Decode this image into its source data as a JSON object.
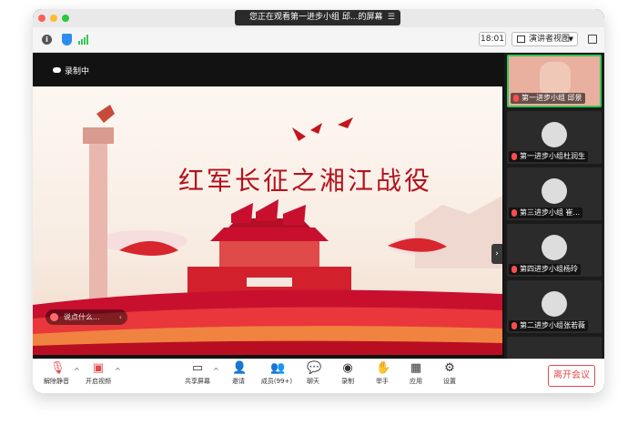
{
  "window": {
    "title": "您正在观看第一进步小组 邱...的屏幕",
    "time": "18:01",
    "view_mode": "演讲者视图"
  },
  "main": {
    "recording_label": "录制中",
    "slide_title": "红军长征之湘江战役",
    "chat_placeholder": "说点什么..."
  },
  "participants": [
    {
      "name": "第一进步小组 邱景",
      "active": true
    },
    {
      "name": "第一进步小组杜润生",
      "active": false
    },
    {
      "name": "第三进步小组 崔...",
      "active": false
    },
    {
      "name": "第四进步小组杨玲",
      "active": false
    },
    {
      "name": "第二进步小组张若薇",
      "active": false
    }
  ],
  "toolbar": {
    "unmute": "解除静音",
    "start_video": "开启视频",
    "share_screen": "共享屏幕",
    "invite": "邀请",
    "members": "成员(99+)",
    "chat": "聊天",
    "record": "录制",
    "raise_hand": "举手",
    "apps": "应用",
    "settings": "设置",
    "leave": "离开会议"
  },
  "colors": {
    "leave_red": "#e04b4b",
    "slide_red": "#b3121d",
    "active_border": "#34c759",
    "muted_red": "#ff4d4f"
  }
}
